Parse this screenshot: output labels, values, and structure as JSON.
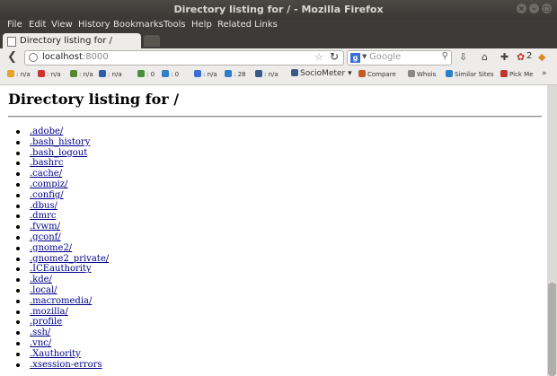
{
  "window": {
    "title": "Directory listing for / - Mozilla Firefox"
  },
  "menubar": {
    "items": [
      "File",
      "Edit",
      "View",
      "History",
      "Bookmarks",
      "Tools",
      "Help",
      "Related Links"
    ]
  },
  "tab": {
    "label": "Directory listing for /"
  },
  "navbar": {
    "url_host": "localhost",
    "url_port": ":8000",
    "search_placeholder": "Google",
    "badge_count": "2"
  },
  "bookmarks": {
    "items": [
      {
        "label": ": n/a",
        "icon": "pagerank-icon",
        "color": "#e8a32a"
      },
      {
        "label": ": n/a",
        "icon": "alexa-icon",
        "color": "#cc3333"
      },
      {
        "label": ": n/a",
        "icon": "compete-icon",
        "color": "#558833"
      },
      {
        "label": ": n/a",
        "icon": "alexa-a-icon",
        "color": "#2d5fa8"
      },
      {
        "label": ": 0",
        "icon": "google-icon",
        "color": "#4a8f3c"
      },
      {
        "label": ": 0",
        "icon": "bing-icon",
        "color": "#2d7fc9"
      },
      {
        "label": ": n/a",
        "icon": "yahoo-icon",
        "color": "#3b6fd6"
      },
      {
        "label": ": 28",
        "icon": "backlinks-icon",
        "color": "#2d7fc9"
      },
      {
        "label": ": n/a",
        "icon": "dmoz-icon",
        "color": "#3a5a8a"
      },
      {
        "label": "SocioMeter",
        "icon": "sociometer-icon",
        "color": "#3a5a8a"
      },
      {
        "label": "Compare",
        "icon": "compare-icon",
        "color": "#c45a28"
      },
      {
        "label": "Whois",
        "icon": "whois-icon",
        "color": "#888888"
      },
      {
        "label": "Similar Sites",
        "icon": "similar-sites-icon",
        "color": "#2d7fc9"
      },
      {
        "label": "Pick Me",
        "icon": "pick-me-icon",
        "color": "#c0392b"
      }
    ]
  },
  "page": {
    "heading": "Directory listing for /",
    "entries": [
      ".adobe/",
      ".bash_history",
      ".bash_logout",
      ".bashrc",
      ".cache/",
      ".compiz/",
      ".config/",
      ".dbus/",
      ".dmrc",
      ".fvwm/",
      ".gconf/",
      ".gnome2/",
      ".gnome2_private/",
      ".ICEauthority",
      ".kde/",
      ".local/",
      ".macromedia/",
      ".mozilla/",
      ".profile",
      ".ssh/",
      ".vnc/",
      ".Xauthority",
      ".xsession-errors"
    ]
  }
}
